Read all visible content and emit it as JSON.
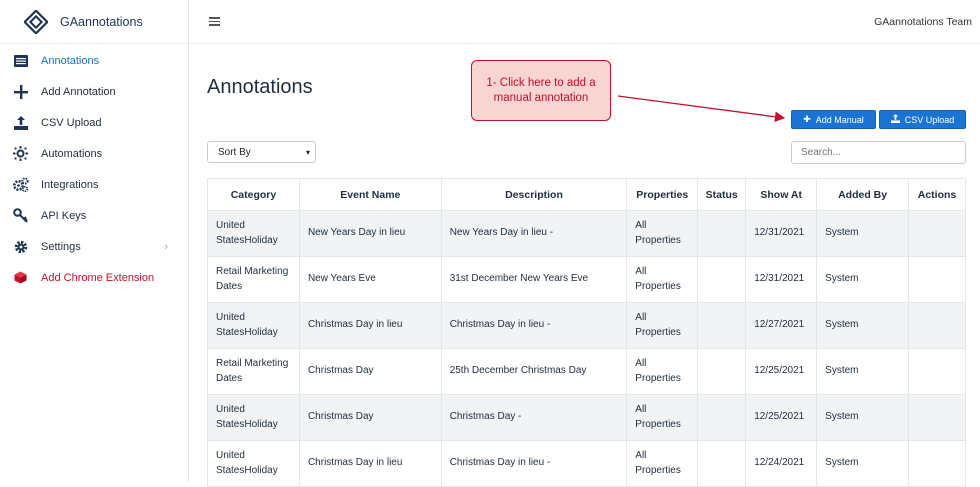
{
  "brand": {
    "name": "GAannotations"
  },
  "sidebar": {
    "items": [
      {
        "label": "Annotations",
        "icon": "list-icon"
      },
      {
        "label": "Add Annotation",
        "icon": "plus-icon"
      },
      {
        "label": "CSV Upload",
        "icon": "upload-icon"
      },
      {
        "label": "Automations",
        "icon": "automation-icon"
      },
      {
        "label": "Integrations",
        "icon": "gears-icon"
      },
      {
        "label": "API Keys",
        "icon": "key-icon"
      },
      {
        "label": "Settings",
        "icon": "gear-icon"
      },
      {
        "label": "Add Chrome Extension",
        "icon": "cube-icon"
      }
    ]
  },
  "topbar": {
    "team": "GAannotations Team"
  },
  "main": {
    "title": "Annotations",
    "callout": "1- Click here to add a manual annotation",
    "add_manual_label": "Add Manual",
    "csv_upload_label": "CSV Upload",
    "sort_label": "Sort By",
    "search_placeholder": "Search..."
  },
  "table": {
    "headers": [
      "Category",
      "Event Name",
      "Description",
      "Properties",
      "Status",
      "Show At",
      "Added By",
      "Actions"
    ],
    "rows": [
      {
        "category": "United StatesHoliday",
        "event": "New Years Day in lieu",
        "description": "New Years Day in lieu -",
        "properties": "All Properties",
        "status": "",
        "show_at": "12/31/2021",
        "added_by": "System",
        "actions": ""
      },
      {
        "category": "Retail Marketing Dates",
        "event": "New Years Eve",
        "description": "31st December New Years Eve",
        "properties": "All Properties",
        "status": "",
        "show_at": "12/31/2021",
        "added_by": "System",
        "actions": ""
      },
      {
        "category": "United StatesHoliday",
        "event": "Christmas Day in lieu",
        "description": "Christmas Day in lieu -",
        "properties": "All Properties",
        "status": "",
        "show_at": "12/27/2021",
        "added_by": "System",
        "actions": ""
      },
      {
        "category": "Retail Marketing Dates",
        "event": "Christmas Day",
        "description": "25th December Christmas Day",
        "properties": "All Properties",
        "status": "",
        "show_at": "12/25/2021",
        "added_by": "System",
        "actions": ""
      },
      {
        "category": "United StatesHoliday",
        "event": "Christmas Day",
        "description": "Christmas Day -",
        "properties": "All Properties",
        "status": "",
        "show_at": "12/25/2021",
        "added_by": "System",
        "actions": ""
      },
      {
        "category": "United StatesHoliday",
        "event": "Christmas Day in lieu",
        "description": "Christmas Day in lieu -",
        "properties": "All Properties",
        "status": "",
        "show_at": "12/24/2021",
        "added_by": "System",
        "actions": ""
      }
    ]
  },
  "colors": {
    "accent": "#1b74d4",
    "active_nav": "#1b6fc0",
    "chrome_red": "#c3112b",
    "callout_bg": "#f6d5d2"
  }
}
